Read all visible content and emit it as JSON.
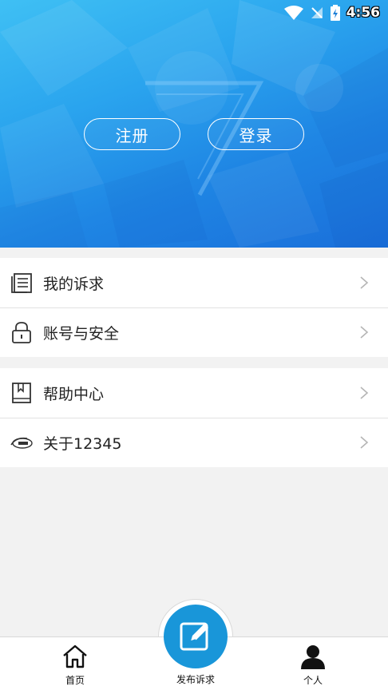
{
  "status_bar": {
    "time": "4:56",
    "icons": [
      "wifi-icon",
      "no-signal-icon",
      "battery-charging-icon"
    ]
  },
  "header": {
    "register_label": "注册",
    "login_label": "登录",
    "colors": {
      "gradient_start": "#3fc0f4",
      "gradient_end": "#1a6fda"
    }
  },
  "menu": {
    "group1": [
      {
        "label": "我的诉求",
        "icon": "list-document-icon"
      },
      {
        "label": "账号与安全",
        "icon": "lock-icon"
      }
    ],
    "group2": [
      {
        "label": "帮助中心",
        "icon": "book-icon"
      },
      {
        "label": "关于12345",
        "icon": "app-logo-icon"
      }
    ]
  },
  "bottom_nav": {
    "home_label": "首页",
    "publish_label": "发布诉求",
    "me_label": "个人",
    "accent_color": "#1996d9"
  }
}
